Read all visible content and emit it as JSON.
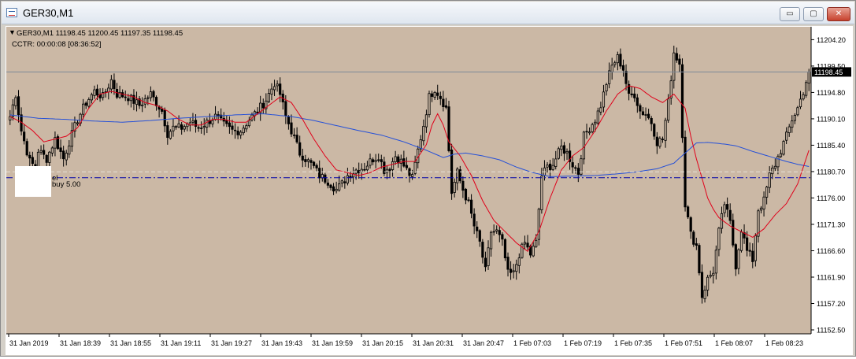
{
  "window": {
    "title": "GER30,M1",
    "buttons": {
      "minimize": "▭",
      "maximize": "▢",
      "close": "✕"
    }
  },
  "info": {
    "line1": "GER30,M1  11198.45 11200.45 11197.35 11198.45",
    "line2": "CCTR: 00:00:08 [08:36:52]",
    "order_label_1": "el",
    "order_label_2": "buy 5.00"
  },
  "colors": {
    "chart_bg": "#cbb8a5",
    "candle": "#000000",
    "ma_fast": "#e0001a",
    "ma_slow": "#2550d8",
    "order_line": "#0000aa",
    "price_tag_bg": "#000000",
    "price_tag_text": "#ffffff"
  },
  "chart_data": {
    "type": "candlestick",
    "symbol": "GER30",
    "timeframe": "M1",
    "current_price": 11198.45,
    "current_price_label": "11198.45",
    "order_price": 11179.6,
    "y_ticks": [
      "11204.20",
      "11199.50",
      "11194.80",
      "11190.10",
      "11185.40",
      "11180.70",
      "11176.00",
      "11171.30",
      "11166.60",
      "11161.90",
      "11157.20",
      "11152.50"
    ],
    "ylim": [
      11151.8,
      11206.5
    ],
    "x_ticks": [
      "31 Jan 2019",
      "31 Jan 18:39",
      "31 Jan 18:55",
      "31 Jan 19:11",
      "31 Jan 19:27",
      "31 Jan 19:43",
      "31 Jan 19:59",
      "31 Jan 20:15",
      "31 Jan 20:31",
      "31 Jan 20:47",
      "1 Feb 07:03",
      "1 Feb 07:19",
      "1 Feb 07:35",
      "1 Feb 07:51",
      "1 Feb 08:07",
      "1 Feb 08:23"
    ],
    "close_anchors": [
      [
        0,
        11190.5
      ],
      [
        2,
        11194.5
      ],
      [
        4,
        11188.0
      ],
      [
        7,
        11182.5
      ],
      [
        9,
        11181.5
      ],
      [
        10,
        11184.5
      ],
      [
        13,
        11183.0
      ],
      [
        16,
        11186.5
      ],
      [
        19,
        11183.0
      ],
      [
        21,
        11186.0
      ],
      [
        24,
        11190.0
      ],
      [
        27,
        11193.0
      ],
      [
        30,
        11195.0
      ],
      [
        33,
        11194.0
      ],
      [
        36,
        11197.0
      ],
      [
        38,
        11194.5
      ],
      [
        42,
        11194.0
      ],
      [
        46,
        11192.5
      ],
      [
        50,
        11194.5
      ],
      [
        54,
        11191.5
      ],
      [
        56,
        11187.5
      ],
      [
        58,
        11188.5
      ],
      [
        61,
        11188.5
      ],
      [
        64,
        11189.5
      ],
      [
        67,
        11188.5
      ],
      [
        70,
        11189.5
      ],
      [
        73,
        11190.5
      ],
      [
        76,
        11189.0
      ],
      [
        79,
        11188.0
      ],
      [
        82,
        11188.0
      ],
      [
        85,
        11190.0
      ],
      [
        88,
        11191.5
      ],
      [
        91,
        11193.5
      ],
      [
        94,
        11196.5
      ],
      [
        96,
        11194.5
      ],
      [
        98,
        11190.5
      ],
      [
        100,
        11188.0
      ],
      [
        103,
        11184.0
      ],
      [
        106,
        11182.5
      ],
      [
        108,
        11181.5
      ],
      [
        110,
        11180.0
      ],
      [
        113,
        11179.0
      ],
      [
        116,
        11177.5
      ],
      [
        118,
        11178.5
      ],
      [
        120,
        11180.0
      ],
      [
        123,
        11181.0
      ],
      [
        126,
        11181.5
      ],
      [
        129,
        11183.0
      ],
      [
        131,
        11183.5
      ],
      [
        133,
        11181.0
      ],
      [
        135,
        11181.5
      ],
      [
        137,
        11183.5
      ],
      [
        139,
        11182.5
      ],
      [
        141,
        11181.0
      ],
      [
        143,
        11179.5
      ],
      [
        145,
        11184.5
      ],
      [
        147,
        11189.0
      ],
      [
        149,
        11194.0
      ],
      [
        151,
        11195.5
      ],
      [
        153,
        11194.0
      ],
      [
        155,
        11192.0
      ],
      [
        157,
        11177.0
      ],
      [
        159,
        11180.5
      ],
      [
        161,
        11177.5
      ],
      [
        163,
        11175.0
      ],
      [
        165,
        11171.0
      ],
      [
        167,
        11168.0
      ],
      [
        169,
        11163.0
      ],
      [
        171,
        11170.0
      ],
      [
        173,
        11170.0
      ],
      [
        175,
        11168.0
      ],
      [
        177,
        11162.5
      ],
      [
        179,
        11162.5
      ],
      [
        181,
        11166.0
      ],
      [
        183,
        11168.0
      ],
      [
        185,
        11166.0
      ],
      [
        187,
        11168.0
      ],
      [
        189,
        11180.0
      ],
      [
        191,
        11181.5
      ],
      [
        193,
        11182.0
      ],
      [
        196,
        11185.0
      ],
      [
        198,
        11184.0
      ],
      [
        200,
        11182.0
      ],
      [
        202,
        11180.5
      ],
      [
        204,
        11187.0
      ],
      [
        206,
        11188.5
      ],
      [
        208,
        11190.0
      ],
      [
        210,
        11192.5
      ],
      [
        212,
        11196.5
      ],
      [
        214,
        11199.5
      ],
      [
        216,
        11201.0
      ],
      [
        218,
        11199.0
      ],
      [
        220,
        11194.0
      ],
      [
        222,
        11194.5
      ],
      [
        224,
        11191.5
      ],
      [
        226,
        11191.0
      ],
      [
        228,
        11189.5
      ],
      [
        230,
        11186.0
      ],
      [
        232,
        11186.5
      ],
      [
        234,
        11193.0
      ],
      [
        236,
        11202.0
      ],
      [
        238,
        11200.0
      ],
      [
        240,
        11175.0
      ],
      [
        242,
        11169.5
      ],
      [
        244,
        11167.5
      ],
      [
        246,
        11158.5
      ],
      [
        248,
        11161.5
      ],
      [
        250,
        11163.0
      ],
      [
        252,
        11170.0
      ],
      [
        254,
        11175.0
      ],
      [
        256,
        11171.5
      ],
      [
        258,
        11164.0
      ],
      [
        260,
        11170.5
      ],
      [
        262,
        11166.5
      ],
      [
        264,
        11165.0
      ],
      [
        266,
        11174.0
      ],
      [
        268,
        11175.5
      ],
      [
        270,
        11180.0
      ],
      [
        272,
        11182.0
      ],
      [
        274,
        11184.5
      ],
      [
        276,
        11187.0
      ],
      [
        278,
        11190.0
      ],
      [
        280,
        11192.0
      ],
      [
        282,
        11195.0
      ],
      [
        284,
        11198.5
      ]
    ],
    "ma_fast_anchors": [
      [
        0,
        11190.5
      ],
      [
        4,
        11189.5
      ],
      [
        8,
        11188.0
      ],
      [
        12,
        11186.0
      ],
      [
        16,
        11186.5
      ],
      [
        20,
        11187.0
      ],
      [
        24,
        11188.5
      ],
      [
        28,
        11192.0
      ],
      [
        32,
        11194.5
      ],
      [
        36,
        11195.0
      ],
      [
        40,
        11194.5
      ],
      [
        44,
        11194.0
      ],
      [
        48,
        11193.0
      ],
      [
        52,
        11192.5
      ],
      [
        56,
        11191.5
      ],
      [
        60,
        11190.0
      ],
      [
        64,
        11189.0
      ],
      [
        68,
        11189.0
      ],
      [
        72,
        11190.0
      ],
      [
        76,
        11190.0
      ],
      [
        80,
        11189.5
      ],
      [
        84,
        11189.5
      ],
      [
        88,
        11191.0
      ],
      [
        92,
        11192.5
      ],
      [
        96,
        11194.0
      ],
      [
        100,
        11193.0
      ],
      [
        104,
        11190.0
      ],
      [
        108,
        11186.5
      ],
      [
        112,
        11183.5
      ],
      [
        116,
        11181.0
      ],
      [
        120,
        11180.5
      ],
      [
        124,
        11180.0
      ],
      [
        128,
        11180.5
      ],
      [
        132,
        11181.5
      ],
      [
        136,
        11182.0
      ],
      [
        140,
        11182.5
      ],
      [
        144,
        11182.5
      ],
      [
        148,
        11185.5
      ],
      [
        150,
        11189.0
      ],
      [
        152,
        11191.0
      ],
      [
        154,
        11189.0
      ],
      [
        156,
        11186.0
      ],
      [
        160,
        11183.5
      ],
      [
        164,
        11180.0
      ],
      [
        168,
        11175.5
      ],
      [
        172,
        11172.0
      ],
      [
        176,
        11170.0
      ],
      [
        180,
        11168.0
      ],
      [
        184,
        11166.5
      ],
      [
        188,
        11170.0
      ],
      [
        192,
        11176.0
      ],
      [
        196,
        11181.0
      ],
      [
        200,
        11183.5
      ],
      [
        204,
        11185.0
      ],
      [
        208,
        11188.0
      ],
      [
        212,
        11191.5
      ],
      [
        216,
        11194.5
      ],
      [
        220,
        11196.0
      ],
      [
        224,
        11195.5
      ],
      [
        228,
        11194.0
      ],
      [
        232,
        11193.0
      ],
      [
        236,
        11194.5
      ],
      [
        240,
        11192.0
      ],
      [
        242,
        11187.0
      ],
      [
        244,
        11183.0
      ],
      [
        246,
        11179.5
      ],
      [
        248,
        11176.0
      ],
      [
        250,
        11174.0
      ],
      [
        252,
        11172.5
      ],
      [
        256,
        11171.0
      ],
      [
        260,
        11170.0
      ],
      [
        264,
        11169.0
      ],
      [
        268,
        11170.5
      ],
      [
        272,
        11173.0
      ],
      [
        276,
        11175.0
      ],
      [
        280,
        11178.5
      ],
      [
        284,
        11184.5
      ]
    ],
    "ma_slow_anchors": [
      [
        0,
        11190.8
      ],
      [
        10,
        11190.2
      ],
      [
        20,
        11190.0
      ],
      [
        30,
        11189.7
      ],
      [
        40,
        11189.5
      ],
      [
        50,
        11189.8
      ],
      [
        60,
        11190.2
      ],
      [
        70,
        11190.5
      ],
      [
        80,
        11190.8
      ],
      [
        90,
        11191.0
      ],
      [
        100,
        11190.5
      ],
      [
        108,
        11189.8
      ],
      [
        116,
        11188.9
      ],
      [
        124,
        11188.0
      ],
      [
        132,
        11187.2
      ],
      [
        140,
        11186.0
      ],
      [
        148,
        11184.5
      ],
      [
        154,
        11183.2
      ],
      [
        158,
        11183.8
      ],
      [
        162,
        11184.0
      ],
      [
        168,
        11183.5
      ],
      [
        174,
        11182.8
      ],
      [
        180,
        11181.5
      ],
      [
        186,
        11180.5
      ],
      [
        192,
        11179.8
      ],
      [
        200,
        11179.9
      ],
      [
        208,
        11180.0
      ],
      [
        216,
        11180.3
      ],
      [
        222,
        11180.6
      ],
      [
        230,
        11181.2
      ],
      [
        236,
        11182.2
      ],
      [
        240,
        11184.0
      ],
      [
        244,
        11185.8
      ],
      [
        248,
        11185.9
      ],
      [
        254,
        11185.6
      ],
      [
        258,
        11185.3
      ],
      [
        264,
        11184.3
      ],
      [
        270,
        11183.4
      ],
      [
        276,
        11182.5
      ],
      [
        280,
        11182.0
      ],
      [
        284,
        11181.6
      ]
    ]
  }
}
